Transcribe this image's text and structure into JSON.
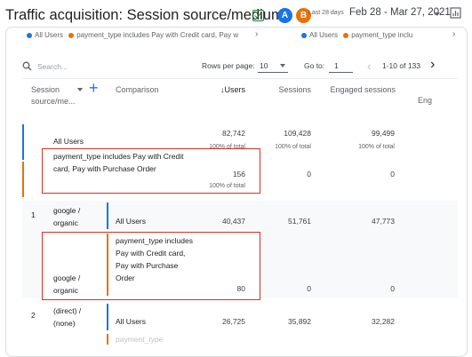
{
  "header": {
    "title": "Traffic acquisition: Session source/medium",
    "avatar_a": "A",
    "avatar_b": "B",
    "last_days": "Last 28 days",
    "date_range": "Feb 28 - Mar 27, 2021"
  },
  "legend_left": [
    {
      "label": "All Users",
      "color": "#1a73e8"
    },
    {
      "label": "payment_type includes Pay with Credit card, Pay w",
      "color": "#e8710a"
    }
  ],
  "legend_right": [
    {
      "label": "All Users",
      "color": "#1a73e8"
    },
    {
      "label": "payment_type inclu",
      "color": "#e8710a"
    }
  ],
  "toolbar": {
    "search_placeholder": "Search...",
    "rows_per_page_label": "Rows per page:",
    "rows_per_page_value": "10",
    "goto_label": "Go to:",
    "goto_value": "1",
    "pagination": "1-10 of 133"
  },
  "columns": {
    "dimension": "Session source/me...",
    "comparison": "Comparison",
    "users": "↓Users",
    "sessions": "Sessions",
    "engaged": "Engaged sessions",
    "overflow": "Eng"
  },
  "totals": {
    "all_users": {
      "label": "All Users",
      "users": "82,742",
      "users_pct": "100% of total",
      "sessions": "109,428",
      "sessions_pct": "100% of total",
      "engaged": "99,499",
      "engaged_pct": "100% of total"
    },
    "payment": {
      "label": "payment_type includes Pay with Credit card, Pay with Purchase Order",
      "users": "156",
      "users_pct": "100% of total",
      "sessions": "0",
      "engaged": "0"
    }
  },
  "rows": [
    {
      "index": "1",
      "source": "google / organic",
      "comparisons": [
        {
          "label": "All Users",
          "users": "40,437",
          "sessions": "51,761",
          "engaged": "47,773"
        },
        {
          "label": "payment_type includes Pay with Credit card, Pay with Purchase Order",
          "users": "80",
          "sessions": "0",
          "engaged": "0"
        }
      ]
    },
    {
      "index": "2",
      "source": "(direct) / (none)",
      "comparisons": [
        {
          "label": "All Users",
          "users": "26,725",
          "sessions": "35,892",
          "engaged": "32,282"
        },
        {
          "label": "payment_type",
          "users": "",
          "sessions": "",
          "engaged": ""
        }
      ]
    }
  ],
  "colors": {
    "blue": "#1a73e8",
    "orange": "#e8710a",
    "red": "#d93025",
    "green": "#188038"
  }
}
